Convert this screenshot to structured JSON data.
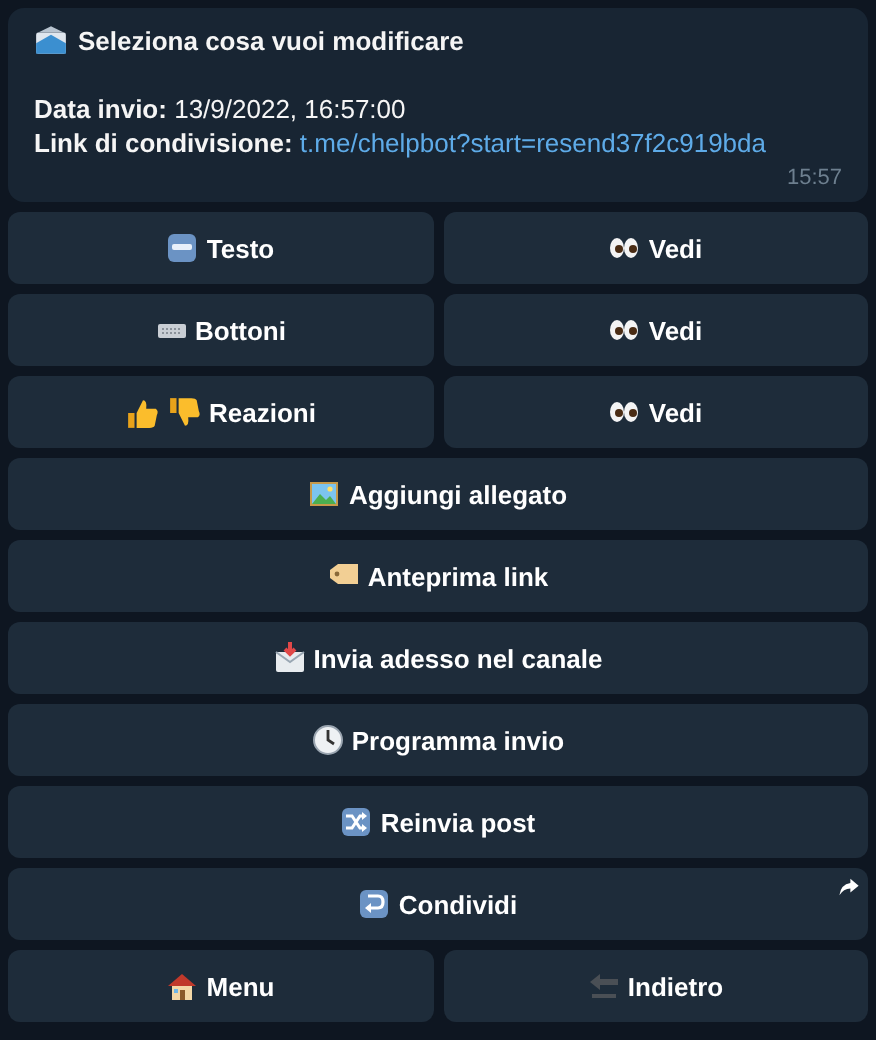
{
  "message": {
    "title": "Seleziona cosa vuoi modificare",
    "title_icon": {
      "kind": "envelope"
    },
    "fields": [
      {
        "label": "Data invio:",
        "value": "13/9/2022, 16:57:00",
        "kind": "text"
      },
      {
        "label": "Link di condivisione:",
        "value": "t.me/chelpbot?start=resend37f2c919bda",
        "kind": "link"
      }
    ],
    "time": "15:57"
  },
  "keyboard": [
    [
      {
        "label": "Testo",
        "icons": [
          {
            "kind": "abc"
          }
        ],
        "kind": "callback"
      },
      {
        "label": "Vedi",
        "icons": [
          {
            "kind": "eyes"
          }
        ],
        "kind": "callback"
      }
    ],
    [
      {
        "label": "Bottoni",
        "icons": [
          {
            "kind": "keyboard"
          }
        ],
        "kind": "callback"
      },
      {
        "label": "Vedi",
        "icons": [
          {
            "kind": "eyes"
          }
        ],
        "kind": "callback"
      }
    ],
    [
      {
        "label": "Reazioni",
        "icons": [
          {
            "kind": "thumbsup"
          },
          {
            "kind": "thumbsdown"
          }
        ],
        "kind": "callback"
      },
      {
        "label": "Vedi",
        "icons": [
          {
            "kind": "eyes"
          }
        ],
        "kind": "callback"
      }
    ],
    [
      {
        "label": "Aggiungi allegato",
        "kind": "callback"
      }
    ],
    [
      {
        "label": "Anteprima link",
        "icons": [
          {
            "kind": "tag"
          }
        ],
        "kind": "callback"
      }
    ],
    [
      {
        "label": "Invia adesso nel canale",
        "icons": [
          {
            "kind": "inbox"
          }
        ],
        "kind": "callback"
      }
    ],
    [
      {
        "label": "Programma invio",
        "icons": [
          {
            "kind": "clock"
          }
        ],
        "kind": "callback"
      }
    ],
    [
      {
        "label": "Reinvia post",
        "icons": [
          {
            "kind": "shuffle"
          }
        ],
        "kind": "callback"
      }
    ],
    [
      {
        "label": "Condividi",
        "icons": [
          {
            "kind": "loop"
          }
        ],
        "kind": "share"
      }
    ],
    [
      {
        "label": "Menu",
        "icons": [
          {
            "kind": "house"
          }
        ],
        "kind": "callback"
      },
      {
        "label": "Indietro",
        "icons": [
          {
            "kind": "back"
          }
        ],
        "kind": "callback"
      }
    ]
  ]
}
